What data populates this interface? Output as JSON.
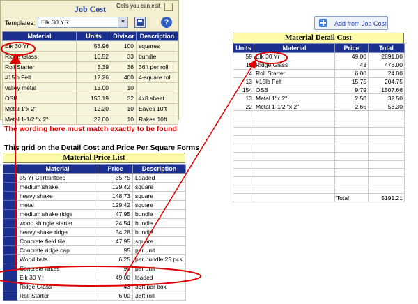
{
  "job_cost": {
    "title": "Job Cost",
    "edit_note": "Cells you can edit",
    "templates_label": "Templates:",
    "template_value": "Elk 30 YR",
    "columns": [
      "Material",
      "Units",
      "Divisor",
      "Description"
    ],
    "rows": [
      [
        "Elk 30 Yr",
        "58.96",
        "100",
        "squares"
      ],
      [
        "Ridge Glass",
        "10.52",
        "33",
        "bundle"
      ],
      [
        "Roll Starter",
        "3.39",
        "36",
        "36ft per roll"
      ],
      [
        "#15lb Felt",
        "12.26",
        "400",
        "4-square roll"
      ],
      [
        "valley metal",
        "13.00",
        "10",
        ""
      ],
      [
        "OSB",
        "153.19",
        "32",
        "4x8 sheet"
      ],
      [
        "Metal 1\"x 2\"",
        "12.20",
        "10",
        "Eaves 10ft"
      ],
      [
        "Metal 1-1/2 \"x 2\"",
        "22.00",
        "10",
        "Rakes 10ft"
      ]
    ]
  },
  "add_button": {
    "label": "Add from Job Cost",
    "icon": "plus-icon"
  },
  "material_detail_cost": {
    "title": "Material Detail Cost",
    "columns": [
      "Units",
      "Material",
      "Price",
      "Total"
    ],
    "rows": [
      [
        "59",
        "Elk 30 Yr",
        "49.00",
        "2891.00"
      ],
      [
        "11",
        "Ridge Glass",
        "43",
        "473.00"
      ],
      [
        "4",
        "Roll Starter",
        "6.00",
        "24.00"
      ],
      [
        "13",
        "#15lb Felt",
        "15.75",
        "204.75"
      ],
      [
        "154",
        "OSB",
        "9.79",
        "1507.66"
      ],
      [
        "13",
        "Metal 1\"x 2\"",
        "2.50",
        "32.50"
      ],
      [
        "22",
        "Metal 1-1/2 \"x 2\"",
        "2.65",
        "58.30"
      ]
    ],
    "total_label": "Total",
    "total_value": "5191.21"
  },
  "annotations": {
    "red_note": "The wording here must match exactly to be found",
    "grid_note": "This grid on the Detail Cost and Price Per Square Forms",
    "highlight_color": "#e00000"
  },
  "material_price_list": {
    "title": "Material Price List",
    "columns": [
      "Material",
      "Price",
      "Description"
    ],
    "rows": [
      [
        "35 Yr Certainteed",
        "35.75",
        "Loaded"
      ],
      [
        "medium shake",
        "129.42",
        "square"
      ],
      [
        "heavy shake",
        "148.73",
        "square"
      ],
      [
        "metal",
        "129.42",
        "square"
      ],
      [
        "medium shake ridge",
        "47.95",
        "bundle"
      ],
      [
        "wood shingle starter",
        "24.54",
        "bundle"
      ],
      [
        "heavy shake ridge",
        "54.28",
        "bundle"
      ],
      [
        "Concrete field tile",
        "47.95",
        "square"
      ],
      [
        "Concrete ridge cap",
        ".95",
        "per unit"
      ],
      [
        "Wood bats",
        "6.25",
        "per bundle 25 pcs"
      ],
      [
        "Concrete rakes",
        ".95",
        "per unit"
      ],
      [
        "Elk 30 Yr",
        "49.00",
        "loaded"
      ],
      [
        "Ridge Glass",
        "43",
        "33ft per box"
      ],
      [
        "Roll Starter",
        "6.00",
        "36ft roll"
      ]
    ]
  }
}
